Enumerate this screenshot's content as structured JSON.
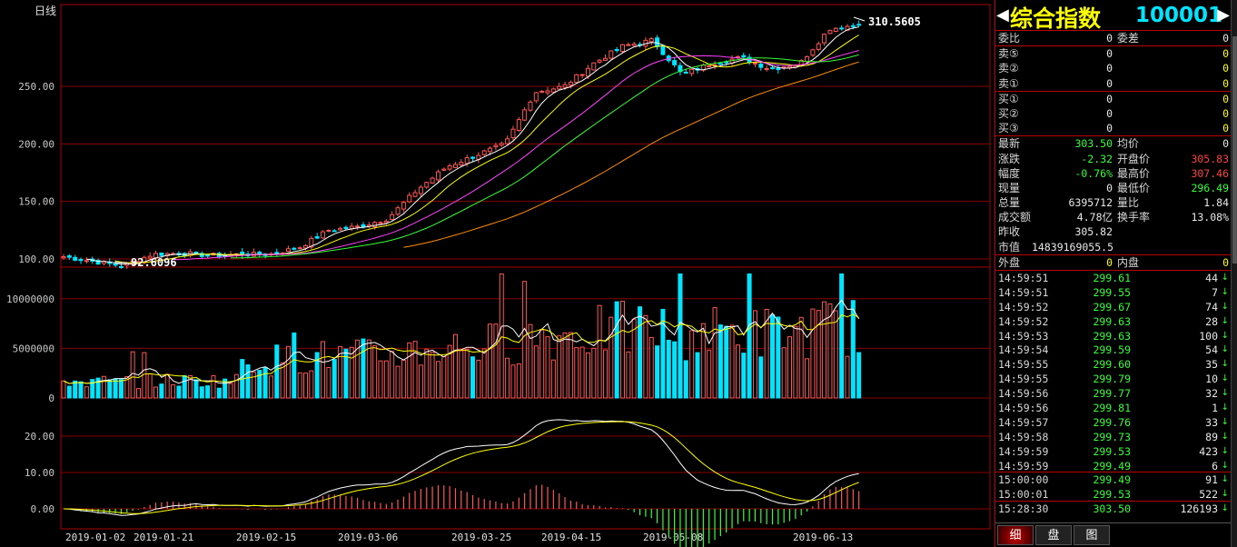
{
  "chart": {
    "period_label": "日线",
    "price_axis": [
      "250.00",
      "200.00",
      "150.00",
      "100.00"
    ],
    "volume_axis": [
      "10000000",
      "5000000",
      "0"
    ],
    "macd_axis": [
      "20.00",
      "10.00",
      "0.00"
    ],
    "date_axis": [
      "2019-01-02",
      "2019-01-21",
      "2019-02-15",
      "2019-03-06",
      "2019-03-25",
      "2019-04-15",
      "2019-05-08",
      "2019-06-13"
    ],
    "high_label": "310.5605",
    "low_label": "92.6096",
    "colors": {
      "up": "#ff5555",
      "down": "#00e5ff",
      "grid": "#8b0000",
      "ma5": "#ffffff",
      "ma10": "#ffff00",
      "ma20": "#ff40ff",
      "ma30": "#33ff33",
      "ma60": "#ff8c00"
    }
  },
  "chart_data": {
    "type": "candlestick",
    "x_range": [
      "2019-01-02",
      "2019-06-20"
    ],
    "price_ylim": [
      92.6,
      310.6
    ],
    "closes_weekly": [
      102,
      98,
      94,
      104,
      105,
      103,
      104,
      104,
      110,
      125,
      128,
      135,
      160,
      180,
      190,
      200,
      245,
      250,
      270,
      285,
      290,
      260,
      270,
      275,
      265,
      270,
      300,
      303.5
    ],
    "volume_ylim": [
      0,
      13000000
    ],
    "macd_ylim": [
      -3,
      26
    ]
  },
  "quote": {
    "name": "综合指数",
    "code": "100001",
    "weibi_label": "委比",
    "weibi": "0",
    "weicha_label": "委差",
    "weicha": "0",
    "sells": [
      {
        "label": "卖⑤",
        "price": "0",
        "vol": "0"
      },
      {
        "label": "卖②",
        "price": "0",
        "vol": "0"
      },
      {
        "label": "卖①",
        "price": "0",
        "vol": "0"
      }
    ],
    "buys": [
      {
        "label": "买①",
        "price": "0",
        "vol": "0"
      },
      {
        "label": "买②",
        "price": "0",
        "vol": "0"
      },
      {
        "label": "买③",
        "price": "0",
        "vol": "0"
      }
    ],
    "stats": [
      {
        "l1": "最新",
        "v1": "303.50",
        "c1": "green",
        "l2": "均价",
        "v2": "0",
        "c2": "white"
      },
      {
        "l1": "涨跌",
        "v1": "-2.32",
        "c1": "green",
        "l2": "开盘价",
        "v2": "305.83",
        "c2": "red"
      },
      {
        "l1": "幅度",
        "v1": "-0.76%",
        "c1": "green",
        "l2": "最高价",
        "v2": "307.46",
        "c2": "red"
      },
      {
        "l1": "现量",
        "v1": "0",
        "c1": "white",
        "l2": "最低价",
        "v2": "296.49",
        "c2": "green"
      },
      {
        "l1": "总量",
        "v1": "6395712",
        "c1": "white",
        "l2": "量比",
        "v2": "1.84",
        "c2": "white"
      },
      {
        "l1": "成交额",
        "v1": "4.78亿",
        "c1": "white",
        "l2": "换手率",
        "v2": "13.08%",
        "c2": "white"
      }
    ],
    "prev_close_label": "昨收",
    "prev_close": "305.82",
    "mkt_cap_label": "市值",
    "mkt_cap": "14839169055.5",
    "outer_label": "外盘",
    "outer": "0",
    "inner_label": "内盘",
    "inner": "0"
  },
  "ticks": [
    {
      "time": "14:59:51",
      "price": "299.61",
      "vol": "44"
    },
    {
      "time": "14:59:51",
      "price": "299.55",
      "vol": "7"
    },
    {
      "time": "14:59:52",
      "price": "299.67",
      "vol": "74"
    },
    {
      "time": "14:59:52",
      "price": "299.63",
      "vol": "28"
    },
    {
      "time": "14:59:53",
      "price": "299.63",
      "vol": "100"
    },
    {
      "time": "14:59:54",
      "price": "299.59",
      "vol": "54"
    },
    {
      "time": "14:59:55",
      "price": "299.60",
      "vol": "35"
    },
    {
      "time": "14:59:55",
      "price": "299.79",
      "vol": "10"
    },
    {
      "time": "14:59:56",
      "price": "299.77",
      "vol": "32"
    },
    {
      "time": "14:59:56",
      "price": "299.81",
      "vol": "1"
    },
    {
      "time": "14:59:57",
      "price": "299.76",
      "vol": "33"
    },
    {
      "time": "14:59:58",
      "price": "299.73",
      "vol": "89"
    },
    {
      "time": "14:59:59",
      "price": "299.53",
      "vol": "423"
    },
    {
      "time": "14:59:59",
      "price": "299.49",
      "vol": "6"
    },
    {
      "time": "15:00:00",
      "price": "299.49",
      "vol": "91"
    },
    {
      "time": "15:00:01",
      "price": "299.53",
      "vol": "522"
    },
    {
      "time": "15:28:30",
      "price": "303.50",
      "vol": "126193"
    }
  ],
  "tick_arrow": "↓",
  "tabs": [
    {
      "label": "细",
      "active": true
    },
    {
      "label": "盘",
      "active": false
    },
    {
      "label": "图",
      "active": false
    }
  ]
}
